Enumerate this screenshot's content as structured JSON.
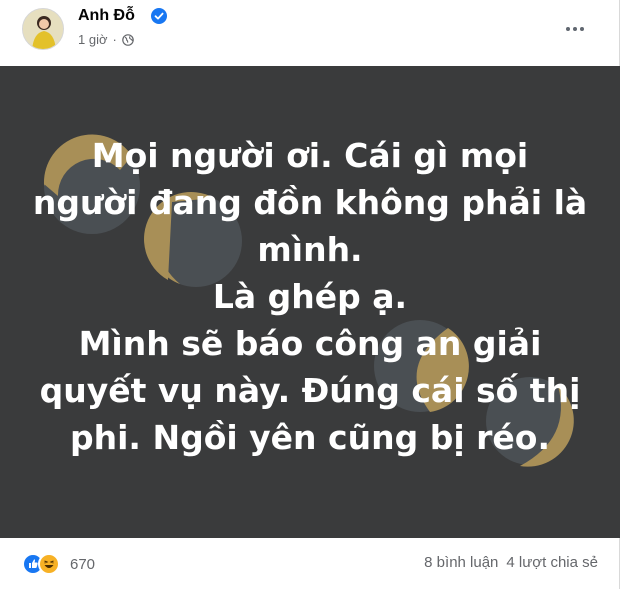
{
  "author": {
    "name": "Anh Đỗ",
    "verified": true,
    "timestamp": "1 giờ",
    "separator": "·",
    "privacy_icon": "globe-icon"
  },
  "header": {
    "more_icon": "more-options-icon"
  },
  "post": {
    "background_color": "#3a3b3c",
    "accent_color": "#a88f57",
    "lines": [
      "Mọi người ơi. Cái gì mọi",
      "người đang đồn không phải là",
      "mình.",
      "Là ghép ạ.",
      "Mình sẽ báo công an giải",
      "quyết vụ này. Đúng cái số thị",
      "phi. Ngồi yên cũng bị réo."
    ]
  },
  "footer": {
    "reaction_icons": [
      "like-icon",
      "haha-icon"
    ],
    "reaction_count": "670",
    "comments": "8 bình luận",
    "shares": "4 lượt chia sẻ"
  }
}
